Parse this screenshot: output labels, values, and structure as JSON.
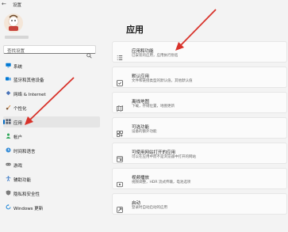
{
  "window": {
    "title": "设置",
    "back_glyph": "←"
  },
  "search": {
    "placeholder": "查找设置"
  },
  "sidebar": {
    "items": [
      {
        "label": "系统",
        "icon": "monitor-icon",
        "color": "#0078d4"
      },
      {
        "label": "蓝牙和其他设备",
        "icon": "bluetooth-icon",
        "color": "#0078d4"
      },
      {
        "label": "网络 & Internet",
        "icon": "wifi-icon",
        "color": "#4a73b8"
      },
      {
        "label": "个性化",
        "icon": "brush-icon",
        "color": "#d08540"
      },
      {
        "label": "应用",
        "icon": "apps-icon",
        "color": "#5a6270",
        "selected": true
      },
      {
        "label": "帐户",
        "icon": "person-icon",
        "color": "#2fa85a"
      },
      {
        "label": "时间和语言",
        "icon": "globe-clock-icon",
        "color": "#3a8fd8"
      },
      {
        "label": "游戏",
        "icon": "gamepad-icon",
        "color": "#707070"
      },
      {
        "label": "辅助功能",
        "icon": "accessibility-icon",
        "color": "#2b6fc2"
      },
      {
        "label": "隐私和安全性",
        "icon": "shield-icon",
        "color": "#7a7a7a"
      },
      {
        "label": "Windows 更新",
        "icon": "update-icon",
        "color": "#0078d4"
      }
    ]
  },
  "main": {
    "title": "应用",
    "cards": [
      {
        "title": "应用和功能",
        "subtitle": "已安装的应用，应用执行别名",
        "icon": "list-icon"
      },
      {
        "title": "默认应用",
        "subtitle": "文件和链接类型的默认值，其他默认值",
        "icon": "default-apps-icon"
      },
      {
        "title": "离线地图",
        "subtitle": "下载，存储位置，地图更新",
        "icon": "map-icon"
      },
      {
        "title": "可选功能",
        "subtitle": "设备的额外功能",
        "icon": "grid-plus-icon"
      },
      {
        "title": "可使用网站打开的应用",
        "subtitle": "可以在应用中而不是浏览器中打开的网站",
        "icon": "web-app-icon"
      },
      {
        "title": "视频播放",
        "subtitle": "视频调整，HDR 流式传输，电池选项",
        "icon": "video-icon"
      },
      {
        "title": "启动",
        "subtitle": "登录时自动启动的应用",
        "icon": "startup-icon"
      }
    ]
  },
  "colors": {
    "accent": "#0067c0",
    "annotation_arrow": "#d8322a"
  }
}
